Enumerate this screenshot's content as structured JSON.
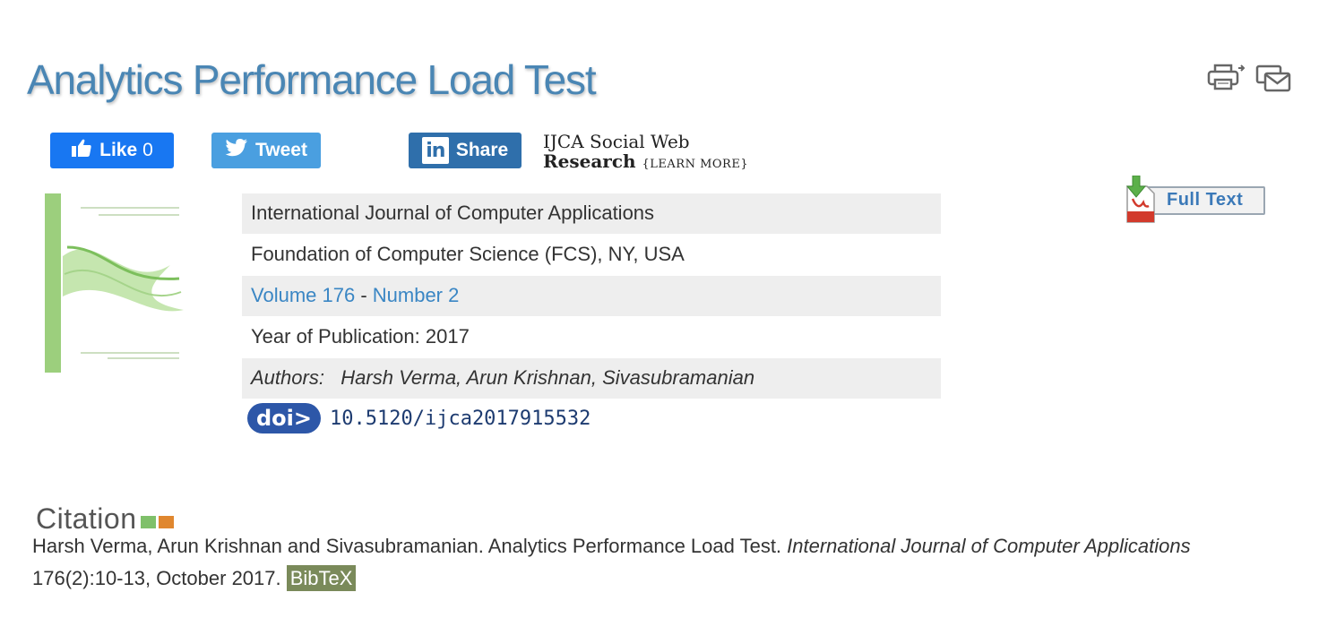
{
  "page": {
    "title": "Analytics Performance Load Test"
  },
  "toolbar": {
    "print_icon": "printer-icon",
    "email_icon": "email-icon"
  },
  "social": {
    "like_label": "Like",
    "like_count": "0",
    "tweet_label": "Tweet",
    "share_label": "Share",
    "linkedin_glyph": "in",
    "ijca_line1": "IJCA Social Web",
    "ijca_line2": "Research",
    "ijca_learn_more": "{LEARN MORE}"
  },
  "info": {
    "journal": "International Journal of Computer Applications",
    "publisher": "Foundation of Computer Science (FCS), NY, USA",
    "volume": "Volume 176",
    "separator": " - ",
    "number": "Number 2",
    "year": "Year of Publication: 2017",
    "authors_label": "Authors:",
    "authors": "Harsh Verma, Arun Krishnan, Sivasubramanian"
  },
  "doi": {
    "logo": "doi>",
    "value": "10.5120/ijca2017915532"
  },
  "fulltext": {
    "label": "Full Text"
  },
  "citation": {
    "logo_word": "Citation",
    "prefix": "Harsh Verma, Arun Krishnan and Sivasubramanian. Analytics Performance Load Test. ",
    "journal": "International Journal of Computer Applications",
    "suffix": " 176(2):10-13, October 2017. ",
    "bibtex": "BibTeX"
  },
  "colors": {
    "title": "#4a86b4",
    "facebook": "#1877f2",
    "twitter": "#4a9fe0",
    "linkedin": "#2f6fab",
    "citation_green": "#7fc06a",
    "citation_orange": "#e0872f",
    "bibtex_bg": "#7a8a5a"
  }
}
